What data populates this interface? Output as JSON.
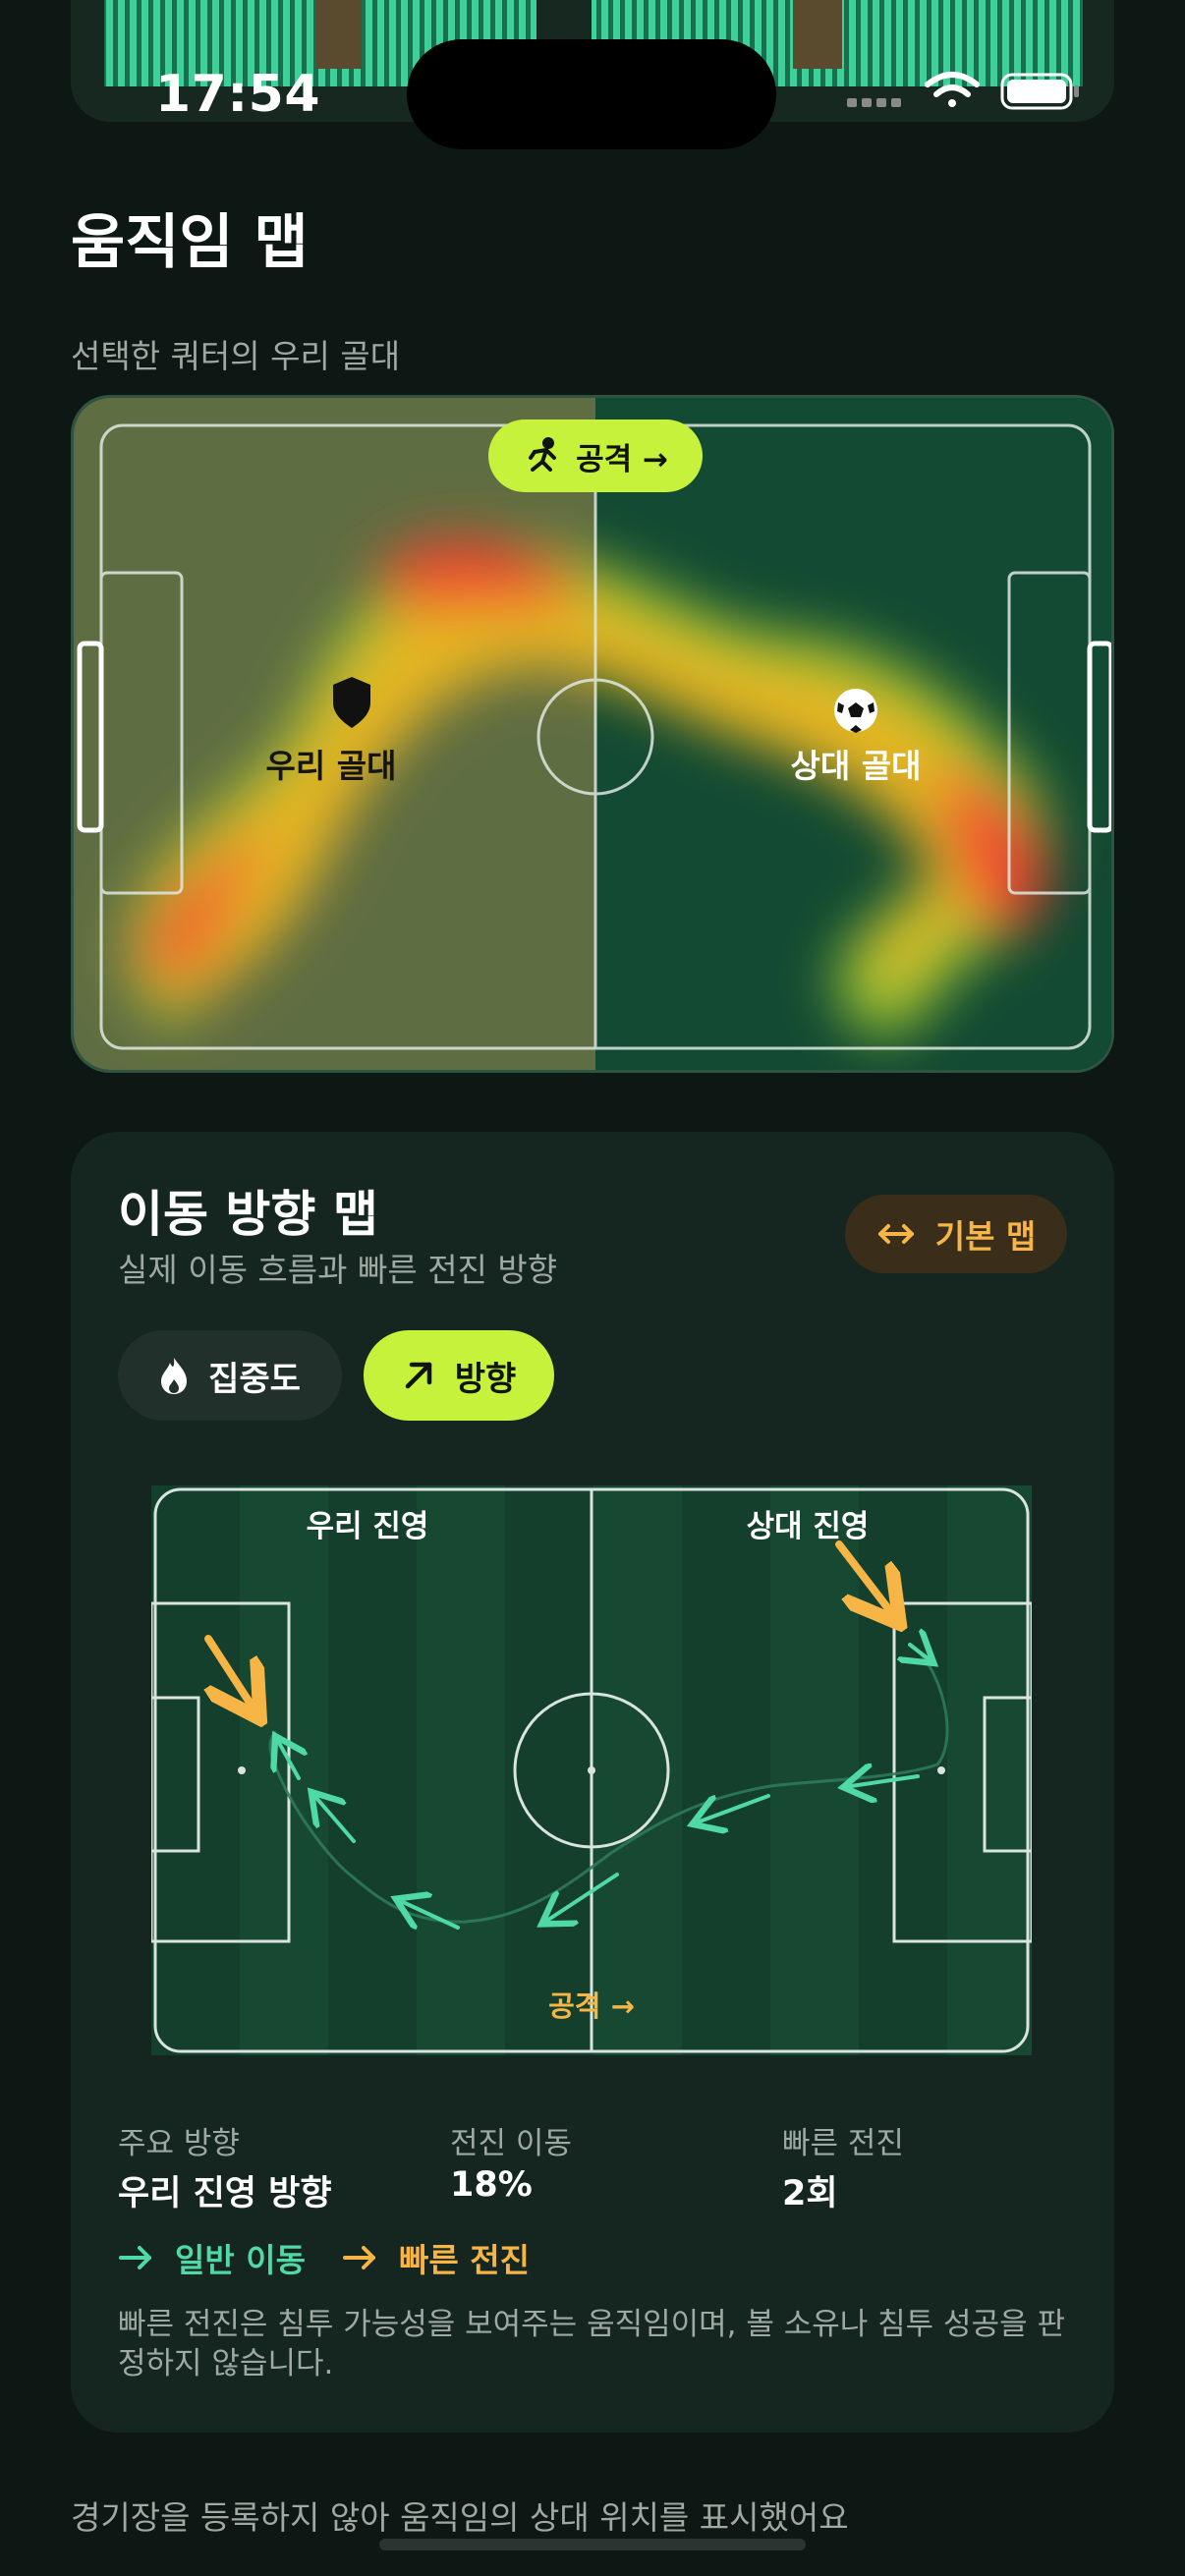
{
  "status_bar": {
    "time": "17:54"
  },
  "page_title": "움직임 맵",
  "heatmap": {
    "subtitle": "선택한 쿼터의 우리 골대",
    "attack_label": "공격 →",
    "our_goal": "우리 골대",
    "their_goal": "상대 골대"
  },
  "direction_map": {
    "title": "이동 방향 맵",
    "subtitle": "실제 이동 흐름과 빠른 전진 방향",
    "basic_map_button": "기본 맵",
    "toggles": {
      "density": "집중도",
      "direction": "방향"
    },
    "field": {
      "our_half": "우리 진영",
      "their_half": "상대 진영",
      "attack_label": "공격 →"
    },
    "stats": [
      {
        "label": "주요 방향",
        "value": "우리 진영 방향"
      },
      {
        "label": "전진 이동",
        "value": "18%"
      },
      {
        "label": "빠른 전진",
        "value": "2회"
      }
    ],
    "legend": {
      "normal": "일반 이동",
      "fast": "빠른 전진"
    },
    "note": "빠른 전진은 침투 가능성을 보여주는 움직임이며, 볼 소유나 침투 성공을 판정하지 않습니다."
  },
  "footer_note": "경기장을 등록하지 않아 움직임의 상대 위치를 표시했어요",
  "colors": {
    "accent": "#c6f23b",
    "normal_move": "#4fd9a6",
    "fast_move": "#f6b545",
    "background": "#0d1713"
  }
}
